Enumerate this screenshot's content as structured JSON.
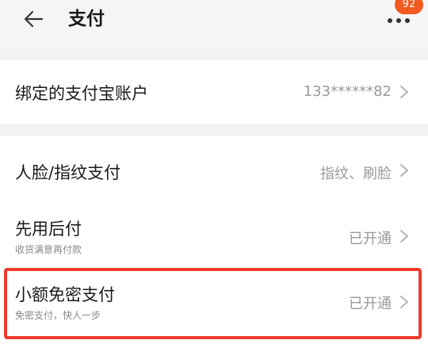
{
  "header": {
    "title": "支付",
    "notification_count": "92"
  },
  "account_section": {
    "label": "绑定的支付宝账户",
    "value": "133******82"
  },
  "payment_section": {
    "items": [
      {
        "label": "人脸/指纹支付",
        "value": "指纹、刷脸",
        "subtitle": ""
      },
      {
        "label": "先用后付",
        "value": "已开通",
        "subtitle": "收货满意再付款"
      },
      {
        "label": "小额免密支付",
        "value": "已开通",
        "subtitle": "免密支付，快人一步"
      }
    ]
  },
  "colors": {
    "accent": "#f25a1f",
    "highlight_border": "#ef3b2e",
    "background": "#f2f2f2"
  },
  "icons": {
    "back": "back-arrow-icon",
    "more": "more-dots-icon",
    "chevron": "chevron-right-icon"
  }
}
